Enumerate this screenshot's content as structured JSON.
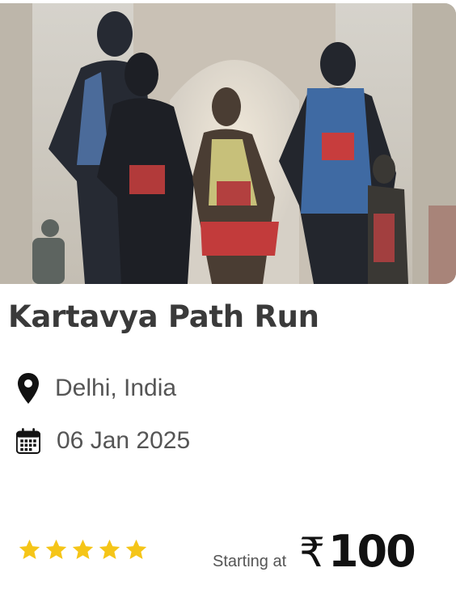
{
  "event": {
    "image_icon": "runners-photo",
    "title": "Kartavya Path Run",
    "location": {
      "icon": "map-pin-icon",
      "text": "Delhi, India"
    },
    "date": {
      "icon": "calendar-icon",
      "text": "06 Jan 2025"
    },
    "rating": {
      "stars": 5,
      "max": 5,
      "color": "#f5c518"
    },
    "price": {
      "label": "Starting at",
      "currency": "₹",
      "amount": "100"
    }
  }
}
